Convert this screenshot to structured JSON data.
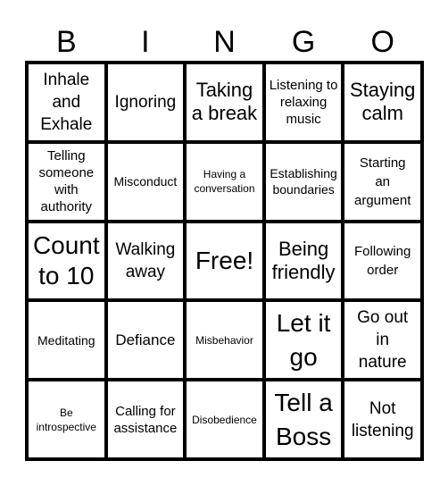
{
  "header": {
    "letters": [
      "B",
      "I",
      "N",
      "G",
      "O"
    ]
  },
  "board": {
    "rows": [
      [
        "Inhale and Exhale",
        "Ignoring",
        "Taking a break",
        "Listening to relaxing music",
        "Staying calm"
      ],
      [
        "Telling someone with authority",
        "Misconduct",
        "Having a conversation",
        "Establishing boundaries",
        "Starting an argument"
      ],
      [
        "Count to 10",
        "Walking away",
        "Free!",
        "Being friendly",
        "Following order"
      ],
      [
        "Meditating",
        "Defiance",
        "Misbehavior",
        "Let it go",
        "Go out in nature"
      ],
      [
        "Be introspective",
        "Calling for assistance",
        "Disobedience",
        "Tell a Boss",
        "Not listening"
      ]
    ]
  }
}
